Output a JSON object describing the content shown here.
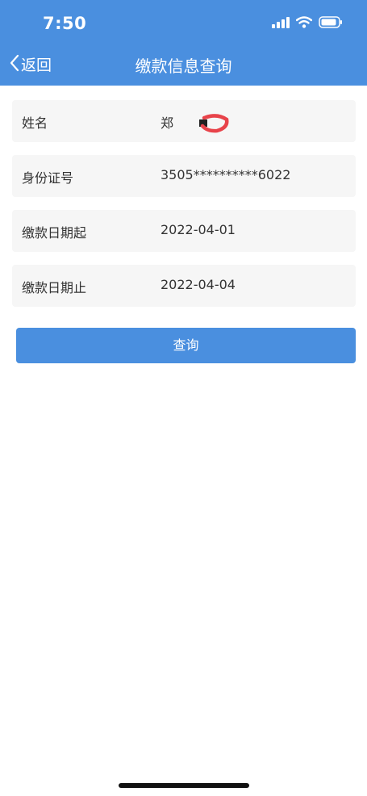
{
  "status_bar": {
    "time": "7:50",
    "icons": [
      "signal-icon",
      "wifi-icon",
      "battery-icon"
    ]
  },
  "nav": {
    "back_label": "返回",
    "title": "缴款信息查询"
  },
  "form": {
    "rows": [
      {
        "label": "姓名",
        "value": "郑"
      },
      {
        "label": "身份证号",
        "value": "3505**********6022"
      },
      {
        "label": "缴款日期起",
        "value": "2022-04-01"
      },
      {
        "label": "缴款日期止",
        "value": "2022-04-04"
      }
    ]
  },
  "buttons": {
    "query_label": "查询"
  },
  "colors": {
    "primary": "#4a8fdf",
    "row_bg": "#f6f6f6",
    "redaction": "#e8434a"
  }
}
